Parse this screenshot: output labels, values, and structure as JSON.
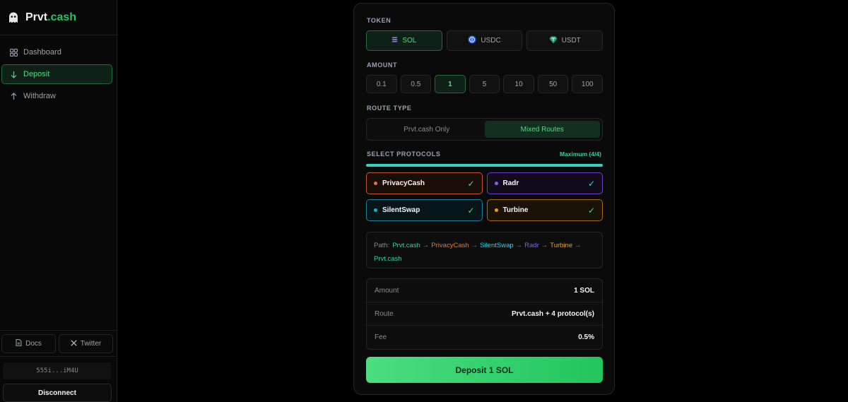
{
  "brand": {
    "name_part1": "Prvt",
    "name_part2": ".cash"
  },
  "sidebar": {
    "items": [
      {
        "label": "Dashboard",
        "icon": "grid-icon"
      },
      {
        "label": "Deposit",
        "icon": "arrow-down-icon",
        "active": true
      },
      {
        "label": "Withdraw",
        "icon": "arrow-up-icon"
      }
    ],
    "links": [
      {
        "label": "Docs",
        "icon": "document-icon"
      },
      {
        "label": "Twitter",
        "icon": "x-icon"
      }
    ],
    "wallet_address": "555i...iM4U",
    "disconnect_label": "Disconnect"
  },
  "form": {
    "token_label": "TOKEN",
    "tokens": [
      {
        "label": "SOL",
        "icon": "solana-icon",
        "active": true
      },
      {
        "label": "USDC",
        "icon": "usdc-icon"
      },
      {
        "label": "USDT",
        "icon": "usdt-icon"
      }
    ],
    "amount_label": "AMOUNT",
    "amounts": [
      "0.1",
      "0.5",
      "1",
      "5",
      "10",
      "50",
      "100"
    ],
    "selected_amount": "1",
    "route_type_label": "ROUTE TYPE",
    "route_options": [
      "Prvt.cash Only",
      "Mixed Routes"
    ],
    "selected_route": "Mixed Routes",
    "protocols_label": "SELECT PROTOCOLS",
    "protocols_max": "Maximum (4/4)",
    "protocols_selected_fraction": 1.0,
    "protocols": [
      {
        "name": "PrivacyCash",
        "color": "#f97316",
        "checked": true
      },
      {
        "name": "Radr",
        "color": "#8b5cf6",
        "checked": true
      },
      {
        "name": "SilentSwap",
        "color": "#06b6d4",
        "checked": true
      },
      {
        "name": "Turbine",
        "color": "#f59e0b",
        "checked": true
      }
    ],
    "check_glyph": "✓",
    "path_label": "Path:",
    "path": [
      "Prvt.cash",
      "PrivacyCash",
      "SilentSwap",
      "Radr",
      "Turbine",
      "Prvt.cash"
    ],
    "arrow_glyph": "→",
    "summary": [
      {
        "key": "Amount",
        "value": "1 SOL"
      },
      {
        "key": "Route",
        "value": "Prvt.cash + 4 protocol(s)"
      },
      {
        "key": "Fee",
        "value": "0.5%"
      }
    ],
    "deposit_label": "Deposit 1 SOL"
  },
  "colors": {
    "accent": "#22c55e",
    "teal": "#2dd4bf",
    "background": "#000000"
  }
}
